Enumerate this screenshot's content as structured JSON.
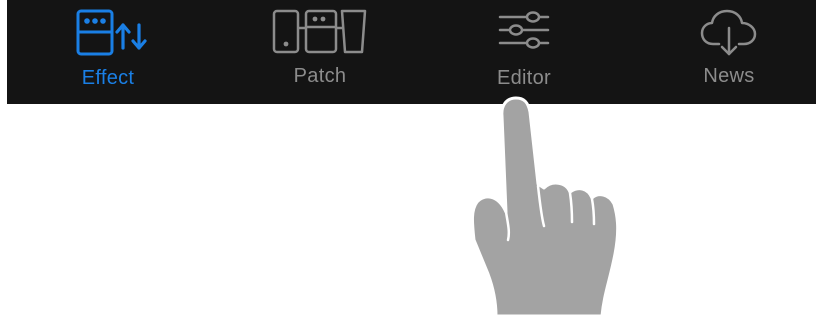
{
  "tabbar": {
    "tabs": [
      {
        "label": "Effect",
        "icon": "effect-pedal-swap-icon",
        "active": true
      },
      {
        "label": "Patch",
        "icon": "patch-pedals-icon",
        "active": false
      },
      {
        "label": "Editor",
        "icon": "sliders-icon",
        "active": false
      },
      {
        "label": "News",
        "icon": "cloud-download-icon",
        "active": false
      }
    ]
  },
  "colors": {
    "tabbar_background": "#141414",
    "active": "#1a7fe5",
    "inactive": "#8c8c8c",
    "pointer_hand": "#a3a3a3"
  },
  "overlay": {
    "icon": "pointing-hand-icon",
    "target_tab": "Editor"
  }
}
